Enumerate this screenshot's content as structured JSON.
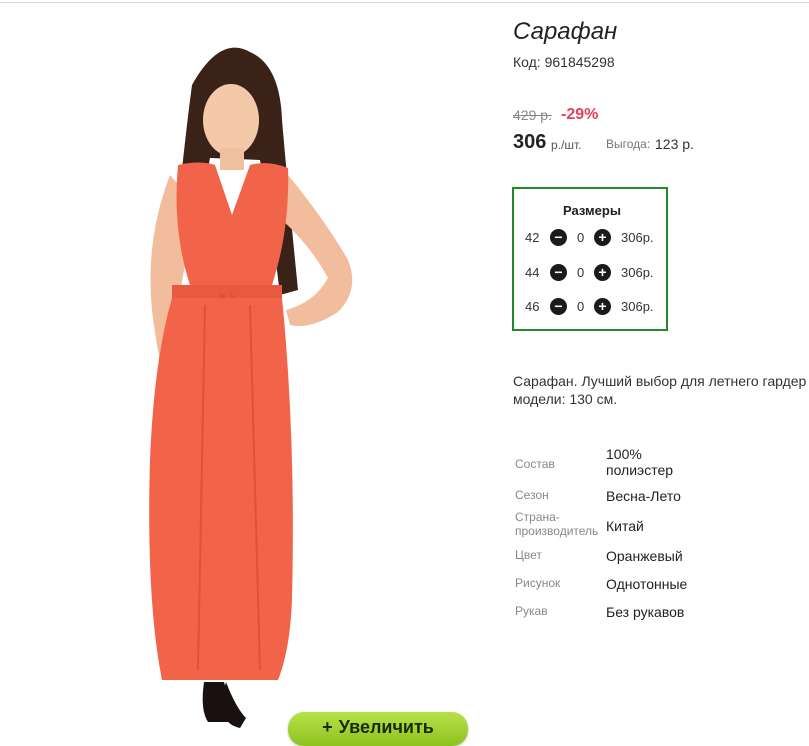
{
  "product": {
    "title": "Сарафан",
    "code": "Код: 961845298",
    "old_price": "429 р.",
    "discount": "-29%",
    "price": "306",
    "price_unit": "р./шт.",
    "benefit_label": "Выгода:",
    "benefit_value": "123 р.",
    "zoom_button": "Увеличить",
    "description_line1": "Сарафан. Лучший выбор для летнего гардер",
    "description_line2": "модели: 130 см."
  },
  "sizes": {
    "title": "Размеры",
    "rows": [
      {
        "size": "42",
        "qty": "0",
        "price": "306р."
      },
      {
        "size": "44",
        "qty": "0",
        "price": "306р."
      },
      {
        "size": "46",
        "qty": "0",
        "price": "306р."
      }
    ]
  },
  "attributes": [
    {
      "key": "Состав",
      "value": "100% полиэстер"
    },
    {
      "key": "Сезон",
      "value": "Весна-Лето"
    },
    {
      "key": "Страна-производитель",
      "value": "Китай"
    },
    {
      "key": "Цвет",
      "value": "Оранжевый"
    },
    {
      "key": "Рисунок",
      "value": "Однотонные"
    },
    {
      "key": "Рукав",
      "value": "Без рукавов"
    }
  ],
  "colors": {
    "accent_green": "#1f8a2a",
    "discount_red": "#e53d5b",
    "dress_orange": "#f26449",
    "zoom_button_green": "#9ccf2c"
  }
}
